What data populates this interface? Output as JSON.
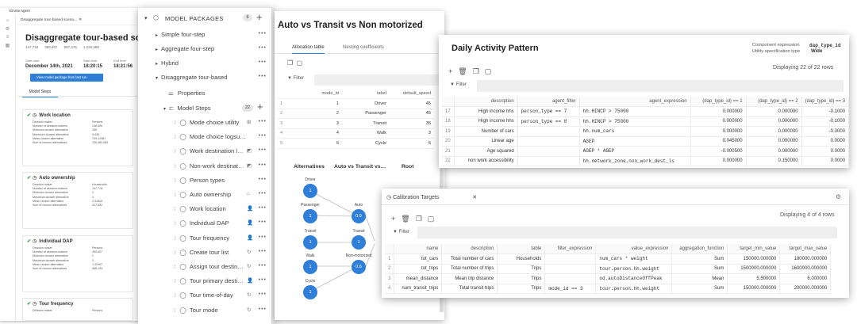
{
  "left": {
    "app_title": "Emme Agent",
    "tab_title": "Disaggregate tour-based scena…",
    "title": "Disaggregate tour-based scena",
    "stats": [
      "147,718",
      "350,607",
      "587,476",
      "1,126,589"
    ],
    "start_date_label": "Start date",
    "start_date": "December 14th, 2021",
    "start_time_label": "Start time",
    "start_time": "18:20:15",
    "end_time_label": "End time",
    "end_time": "18:21:56",
    "view_button": "View model package from last run",
    "tab": "Model Steps",
    "cards": [
      {
        "title": "Work location",
        "rows": [
          [
            "Decision maker",
            "Persons"
          ],
          [
            "Number of decision-makers",
            "148,606"
          ],
          [
            "Minimum chosen alternative",
            "165"
          ],
          [
            "Maximum chosen alternative",
            "9,438"
          ],
          [
            "Mean chosen alternative",
            "709.41981"
          ],
          [
            "Sum of chosen alternatives",
            "105,483,483"
          ]
        ]
      },
      {
        "title": "Auto ownership",
        "rows": [
          [
            "Decision maker",
            "Households"
          ],
          [
            "Number of decision-makers",
            "147,718"
          ],
          [
            "Minimum chosen alternative",
            "1"
          ],
          [
            "Maximum chosen alternative",
            "4"
          ],
          [
            "Mean chosen alternative",
            "2.31843"
          ],
          [
            "Sum of chosen alternatives",
            "327,692"
          ]
        ]
      },
      {
        "title": "Individual DAP",
        "rows": [
          [
            "Decision maker",
            "Persons"
          ],
          [
            "Number of decision-makers",
            "350,607"
          ],
          [
            "Minimum chosen alternative",
            "1"
          ],
          [
            "Maximum chosen alternative",
            "3"
          ],
          [
            "Mean chosen alternative",
            "1.32997"
          ],
          [
            "Sum of chosen alternatives",
            "466,193"
          ]
        ]
      },
      {
        "title": "Tour frequency",
        "rows": [
          [
            "Decision maker",
            "Persons"
          ]
        ]
      }
    ]
  },
  "tree": {
    "header": "MODEL PACKAGES",
    "count": "6",
    "items": [
      "Simple four-step",
      "Aggregate four-step",
      "Hybrid",
      "Disaggregate tour-based"
    ],
    "properties": "Properties",
    "model_steps": "Model Steps",
    "steps_count": "22",
    "steps": [
      "Mode choice utility",
      "Mode choice logsu…",
      "Work destination l…",
      "Non-work destinat…",
      "Person types",
      "Auto ownership",
      "Work location",
      "Individual DAP",
      "Tour frequency",
      "Create tour list",
      "Assign tour destin…",
      "Tour primary desti…",
      "Tour time-of-day",
      "Tour mode"
    ]
  },
  "avt": {
    "title": "Auto vs Transit vs Non motorized",
    "tabs": [
      "Allocation table",
      "Nesting coefficients"
    ],
    "filter": "Filter",
    "columns": [
      "mode_id",
      "label",
      "default_speed"
    ],
    "rows": [
      [
        "1",
        "1",
        "Driver",
        "45"
      ],
      [
        "2",
        "2",
        "Passenger",
        "45"
      ],
      [
        "3",
        "3",
        "Transit",
        "35"
      ],
      [
        "4",
        "4",
        "Walk",
        "3"
      ],
      [
        "5",
        "5",
        "Cycle",
        "5"
      ]
    ],
    "tree_headers": [
      "Alternatives",
      "Auto vs Transit vs…",
      "Root"
    ],
    "nodes": {
      "driver": "Driver",
      "passenger": "Passenger",
      "auto": "Auto",
      "transit": "Transit",
      "transit2": "Transit",
      "walk": "Walk",
      "nonmot": "Non-motorized",
      "cycle": "Cycle",
      "one": "1",
      "auto_val": "0.9",
      "nonmot_val": "0.6"
    }
  },
  "dap": {
    "title": "Daily Activity Pattern",
    "expr_label": "Component expression",
    "expr_value": "dap_type_id",
    "spec_label": "Utility specification type",
    "spec_value": "Wide",
    "displaying": "Displaying 22 of 22 rows",
    "filter": "Filter",
    "columns": [
      "description",
      "agent_filter",
      "agent_expression",
      "(dap_type_id) == 1",
      "(dap_type_id) == 2",
      "(dap_type_id) == 3"
    ],
    "rows": [
      [
        "17",
        "High income hhs",
        "person_type == 7",
        "hh.HINCP > 75000",
        "0.000000",
        "0.000000",
        "-0.1000"
      ],
      [
        "18",
        "High income hhs",
        "person_type == 8",
        "hh.HINCP > 75000",
        "0.000000",
        "0.000000",
        "-0.1000"
      ],
      [
        "19",
        "Number of cars",
        "",
        "hh.num_cars",
        "0.000000",
        "0.000000",
        "-0.3000"
      ],
      [
        "20",
        "Linear age",
        "",
        "AGEP",
        "0.045000",
        "0.000000",
        "0.0000"
      ],
      [
        "21",
        "Age squared",
        "",
        "AGEP * AGEP",
        "-0.000500",
        "0.000000",
        "0.0000"
      ],
      [
        "22",
        "non work accessibility",
        "",
        "hh.network_zone.non_work_dest_ls",
        "0.000000",
        "0.150000",
        "0.0000"
      ]
    ]
  },
  "calib": {
    "title": "Calibration Targets",
    "displaying": "Displaying 4 of 4 rows",
    "filter": "Filter",
    "columns": [
      "name",
      "description",
      "table",
      "filter_expression",
      "value_expression",
      "aggregation_function",
      "target_min_value",
      "target_max_value"
    ],
    "rows": [
      [
        "1",
        "tot_cars",
        "Total number of cars",
        "Households",
        "",
        "num_cars * weight",
        "Sum",
        "150000.000000",
        "180000.000000"
      ],
      [
        "2",
        "tot_trips",
        "Total number of trips",
        "Trips",
        "",
        "tour.person.hh.weight",
        "Sum",
        "1500000.000000",
        "1600000.000000"
      ],
      [
        "3",
        "mean_distance",
        "Mean trip distance",
        "Trips",
        "",
        "od.autoDistanceOffPeak",
        "Mean",
        "5.500000",
        "6.000000"
      ],
      [
        "4",
        "num_transit_trips",
        "Total transit trips",
        "Trips",
        "mode_id == 3",
        "tour.person.hh.weight",
        "Sum",
        "150000.000000",
        "200000.000000"
      ]
    ]
  },
  "colors": {
    "accent": "#2f7fd8",
    "check": "#2e9e45"
  }
}
